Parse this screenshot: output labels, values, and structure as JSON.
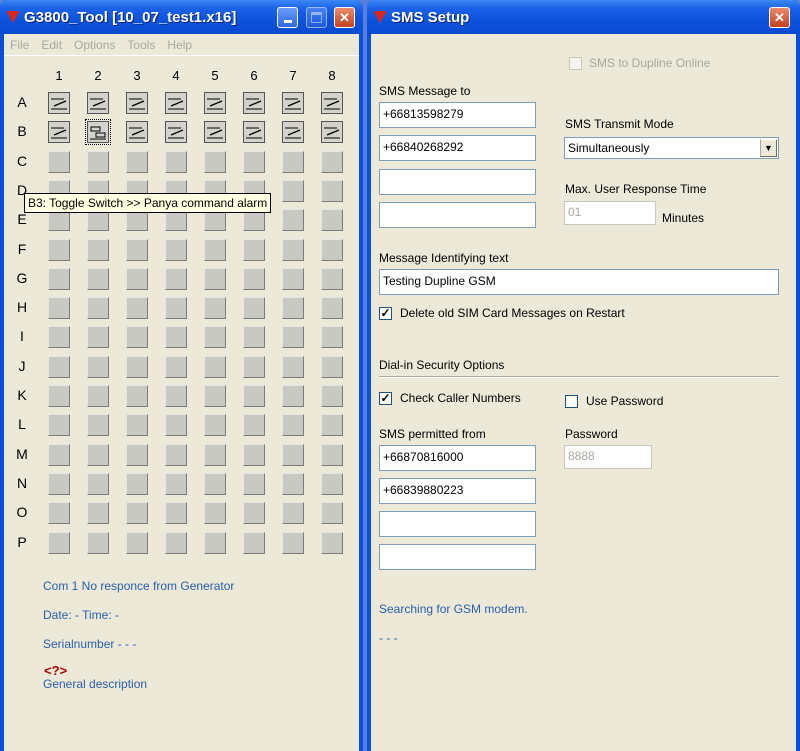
{
  "left_window": {
    "title": "G3800_Tool [10_07_test1.x16]",
    "menu": [
      "File",
      "Edit",
      "Options",
      "Tools",
      "Help"
    ],
    "columns": [
      "1",
      "2",
      "3",
      "4",
      "5",
      "6",
      "7",
      "8"
    ],
    "rows": [
      "A",
      "B",
      "C",
      "D",
      "E",
      "F",
      "G",
      "H",
      "I",
      "J",
      "K",
      "L",
      "M",
      "N",
      "O",
      "P"
    ],
    "switch_rows": [
      "A",
      "B"
    ],
    "selected_cell": "B2",
    "tooltip": "B3: Toggle Switch >> Panya command  alarm",
    "info": {
      "com_status": "Com 1 No responce from Generator",
      "date_time": "Date: - Time: -",
      "serial": "Serialnumber - - -",
      "general_description": "General description",
      "unknown_marker": "<?>"
    },
    "colors": {
      "info_text": "#2a5fa8",
      "marker": "#b00000"
    }
  },
  "right_window": {
    "title": "SMS Setup",
    "sms_to_dupline_online": {
      "label": "SMS to Dupline Online",
      "checked": false,
      "disabled": true
    },
    "sms_message_to": {
      "label": "SMS Message to",
      "numbers": [
        "+66813598279",
        "+66840268292",
        "",
        ""
      ]
    },
    "transmit_mode": {
      "label": "SMS Transmit Mode",
      "value": "Simultaneously"
    },
    "max_response": {
      "label": "Max. User Response Time",
      "value": "01",
      "unit": "Minutes"
    },
    "identifying_text": {
      "label": "Message Identifying text",
      "value": "Testing Dupline GSM"
    },
    "delete_old": {
      "label": "Delete old SIM Card Messages on Restart",
      "checked": true
    },
    "security_header": "Dial-in Security Options",
    "check_caller": {
      "label": "Check Caller Numbers",
      "checked": true
    },
    "use_password": {
      "label": "Use Password",
      "checked": false
    },
    "permitted_from": {
      "label": "SMS permitted from",
      "numbers": [
        "+66870816000",
        "+66839880223",
        "",
        ""
      ]
    },
    "password": {
      "label": "Password",
      "value": "8888"
    },
    "status": "Searching for GSM modem.",
    "status_dots": "- - -"
  }
}
